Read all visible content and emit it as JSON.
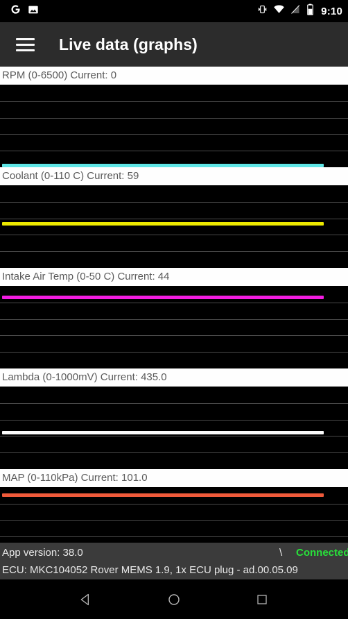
{
  "statusbar": {
    "icons": [
      "google-g-icon",
      "gallery-icon",
      "vibrate-icon",
      "wifi-icon",
      "signal-off-icon",
      "battery-icon"
    ],
    "time": "9:10"
  },
  "appbar": {
    "menu_icon": "hamburger-menu-icon",
    "title": "Live data (graphs)"
  },
  "graphs": [
    {
      "name": "rpm",
      "label": "RPM (0-6500) Current: 0",
      "parameter": "RPM",
      "range_min": 0,
      "range_max": 6500,
      "current": 0,
      "unit": "",
      "color": "#5fe6e6",
      "fill_pct": 0
    },
    {
      "name": "coolant",
      "label": "Coolant (0-110 C) Current: 59",
      "parameter": "Coolant",
      "range_min": 0,
      "range_max": 110,
      "current": 59,
      "unit": "C",
      "color": "#ece800",
      "fill_pct": 53.6
    },
    {
      "name": "intake-air-temp",
      "label": "Intake Air Temp (0-50 C) Current: 44",
      "parameter": "Intake Air Temp",
      "range_min": 0,
      "range_max": 50,
      "current": 44,
      "unit": "C",
      "color": "#f21ce0",
      "fill_pct": 88
    },
    {
      "name": "lambda",
      "label": "Lambda (0-1000mV) Current: 435.0",
      "parameter": "Lambda",
      "range_min": 0,
      "range_max": 1000,
      "current": 435.0,
      "unit": "mV",
      "color": "#fbfbfb",
      "fill_pct": 43.5
    },
    {
      "name": "map",
      "label": "MAP (0-110kPa) Current: 101.0",
      "parameter": "MAP",
      "range_min": 0,
      "range_max": 110,
      "current": 101.0,
      "unit": "kPa",
      "color": "#ef5a3a",
      "fill_pct": 91.8
    }
  ],
  "footer": {
    "app_version": "App version: 38.0",
    "separator": "\\",
    "connection_status": "Connected",
    "connection_color": "#28e03a",
    "ecu_info": "ECU: MKC104052 Rover MEMS 1.9, 1x ECU plug - ad.00.05.09"
  },
  "navbar": {
    "back_icon": "back-triangle-icon",
    "home_icon": "home-circle-icon",
    "recents_icon": "recents-square-icon"
  }
}
